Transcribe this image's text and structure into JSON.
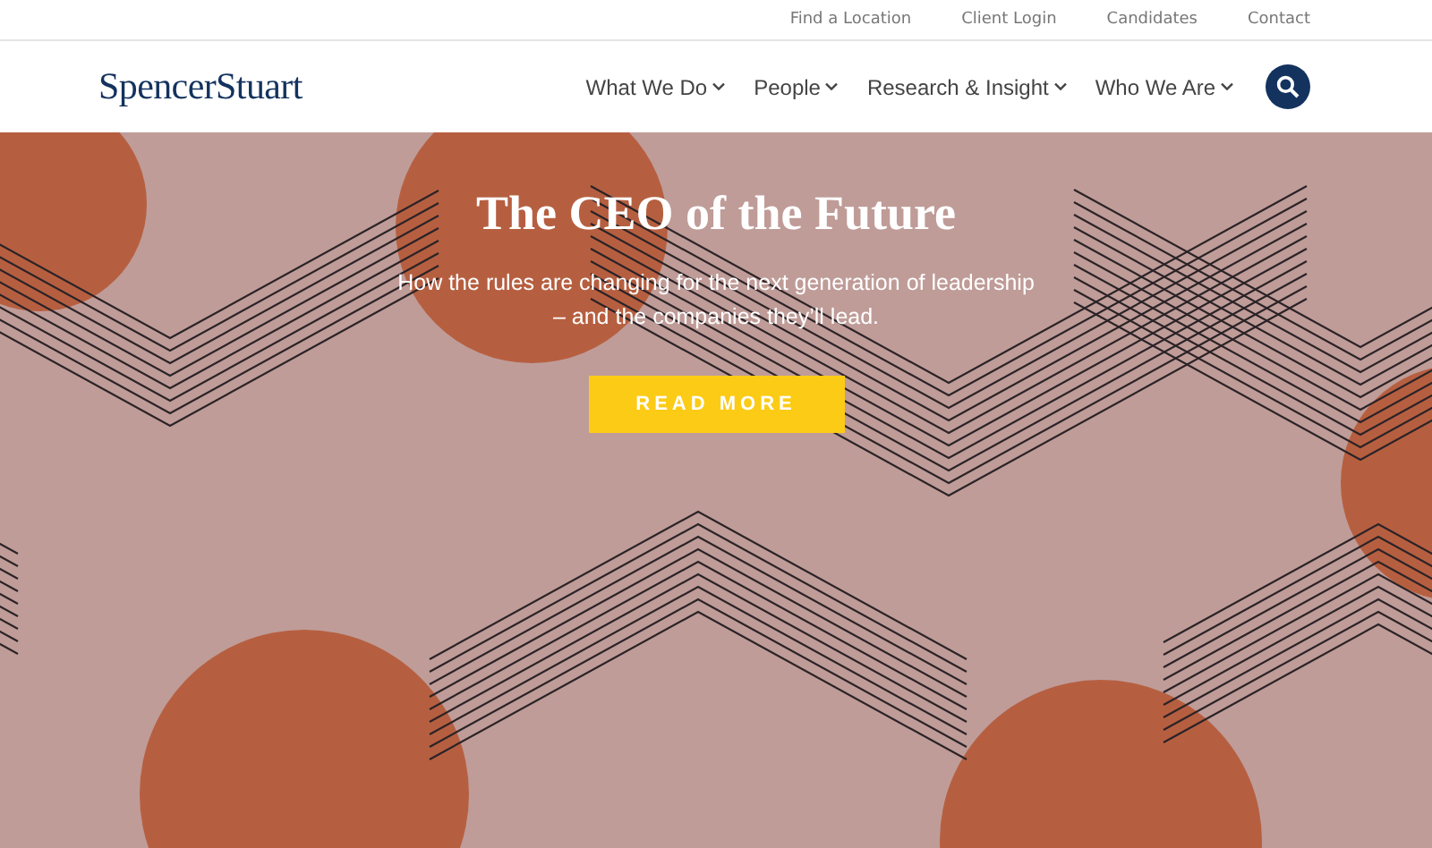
{
  "utility_links": [
    "Find a Location",
    "Client Login",
    "Candidates",
    "Contact"
  ],
  "logo": "SpencerStuart",
  "nav_items": [
    {
      "label": "What We Do",
      "expanded": false
    },
    {
      "label": "People",
      "expanded": false
    },
    {
      "label": "Research & Insight",
      "expanded": false
    },
    {
      "label": "Who We Are",
      "expanded": false
    }
  ],
  "hero": {
    "title": "The CEO of the Future",
    "subtitle_lines": [
      "How the rules are changing for the next generation of leadership",
      "– and the companies they’ll lead."
    ],
    "button": "READ MORE"
  }
}
